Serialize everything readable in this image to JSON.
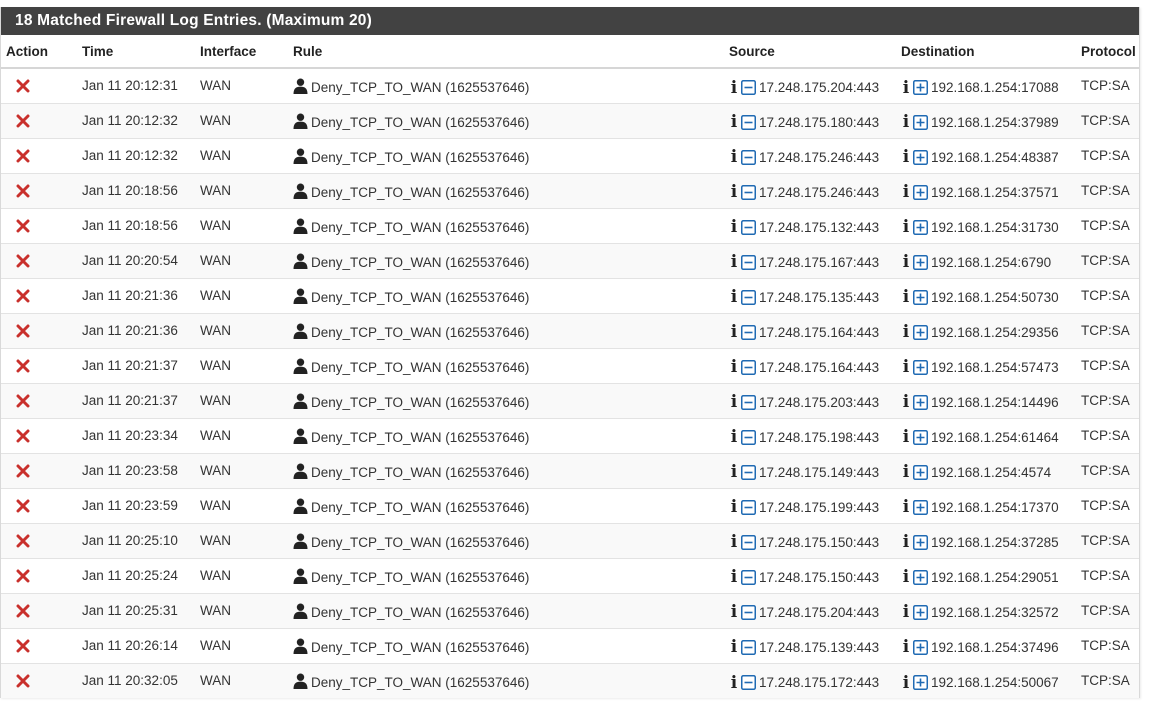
{
  "panel": {
    "title": "18 Matched Firewall Log Entries. (Maximum 20)"
  },
  "columns": {
    "action": "Action",
    "time": "Time",
    "interface": "Interface",
    "rule": "Rule",
    "source": "Source",
    "destination": "Destination",
    "protocol": "Protocol"
  },
  "icons": {
    "action": "block-x-icon",
    "rule": "user-icon",
    "info": "info-icon",
    "source_toggle": "minus-square-icon",
    "destination_toggle": "plus-square-icon"
  },
  "colors": {
    "header_bg": "#424242",
    "block_red": "#c9302c",
    "toggle_blue": "#1f6ab3"
  },
  "rows": [
    {
      "time": "Jan 11 20:12:31",
      "interface": "WAN",
      "rule": "Deny_TCP_TO_WAN (1625537646)",
      "source": "17.248.175.204:443",
      "destination": "192.168.1.254:17088",
      "protocol": "TCP:SA"
    },
    {
      "time": "Jan 11 20:12:32",
      "interface": "WAN",
      "rule": "Deny_TCP_TO_WAN (1625537646)",
      "source": "17.248.175.180:443",
      "destination": "192.168.1.254:37989",
      "protocol": "TCP:SA"
    },
    {
      "time": "Jan 11 20:12:32",
      "interface": "WAN",
      "rule": "Deny_TCP_TO_WAN (1625537646)",
      "source": "17.248.175.246:443",
      "destination": "192.168.1.254:48387",
      "protocol": "TCP:SA"
    },
    {
      "time": "Jan 11 20:18:56",
      "interface": "WAN",
      "rule": "Deny_TCP_TO_WAN (1625537646)",
      "source": "17.248.175.246:443",
      "destination": "192.168.1.254:37571",
      "protocol": "TCP:SA"
    },
    {
      "time": "Jan 11 20:18:56",
      "interface": "WAN",
      "rule": "Deny_TCP_TO_WAN (1625537646)",
      "source": "17.248.175.132:443",
      "destination": "192.168.1.254:31730",
      "protocol": "TCP:SA"
    },
    {
      "time": "Jan 11 20:20:54",
      "interface": "WAN",
      "rule": "Deny_TCP_TO_WAN (1625537646)",
      "source": "17.248.175.167:443",
      "destination": "192.168.1.254:6790",
      "protocol": "TCP:SA"
    },
    {
      "time": "Jan 11 20:21:36",
      "interface": "WAN",
      "rule": "Deny_TCP_TO_WAN (1625537646)",
      "source": "17.248.175.135:443",
      "destination": "192.168.1.254:50730",
      "protocol": "TCP:SA"
    },
    {
      "time": "Jan 11 20:21:36",
      "interface": "WAN",
      "rule": "Deny_TCP_TO_WAN (1625537646)",
      "source": "17.248.175.164:443",
      "destination": "192.168.1.254:29356",
      "protocol": "TCP:SA"
    },
    {
      "time": "Jan 11 20:21:37",
      "interface": "WAN",
      "rule": "Deny_TCP_TO_WAN (1625537646)",
      "source": "17.248.175.164:443",
      "destination": "192.168.1.254:57473",
      "protocol": "TCP:SA"
    },
    {
      "time": "Jan 11 20:21:37",
      "interface": "WAN",
      "rule": "Deny_TCP_TO_WAN (1625537646)",
      "source": "17.248.175.203:443",
      "destination": "192.168.1.254:14496",
      "protocol": "TCP:SA"
    },
    {
      "time": "Jan 11 20:23:34",
      "interface": "WAN",
      "rule": "Deny_TCP_TO_WAN (1625537646)",
      "source": "17.248.175.198:443",
      "destination": "192.168.1.254:61464",
      "protocol": "TCP:SA"
    },
    {
      "time": "Jan 11 20:23:58",
      "interface": "WAN",
      "rule": "Deny_TCP_TO_WAN (1625537646)",
      "source": "17.248.175.149:443",
      "destination": "192.168.1.254:4574",
      "protocol": "TCP:SA"
    },
    {
      "time": "Jan 11 20:23:59",
      "interface": "WAN",
      "rule": "Deny_TCP_TO_WAN (1625537646)",
      "source": "17.248.175.199:443",
      "destination": "192.168.1.254:17370",
      "protocol": "TCP:SA"
    },
    {
      "time": "Jan 11 20:25:10",
      "interface": "WAN",
      "rule": "Deny_TCP_TO_WAN (1625537646)",
      "source": "17.248.175.150:443",
      "destination": "192.168.1.254:37285",
      "protocol": "TCP:SA"
    },
    {
      "time": "Jan 11 20:25:24",
      "interface": "WAN",
      "rule": "Deny_TCP_TO_WAN (1625537646)",
      "source": "17.248.175.150:443",
      "destination": "192.168.1.254:29051",
      "protocol": "TCP:SA"
    },
    {
      "time": "Jan 11 20:25:31",
      "interface": "WAN",
      "rule": "Deny_TCP_TO_WAN (1625537646)",
      "source": "17.248.175.204:443",
      "destination": "192.168.1.254:32572",
      "protocol": "TCP:SA"
    },
    {
      "time": "Jan 11 20:26:14",
      "interface": "WAN",
      "rule": "Deny_TCP_TO_WAN (1625537646)",
      "source": "17.248.175.139:443",
      "destination": "192.168.1.254:37496",
      "protocol": "TCP:SA"
    },
    {
      "time": "Jan 11 20:32:05",
      "interface": "WAN",
      "rule": "Deny_TCP_TO_WAN (1625537646)",
      "source": "17.248.175.172:443",
      "destination": "192.168.1.254:50067",
      "protocol": "TCP:SA"
    }
  ]
}
